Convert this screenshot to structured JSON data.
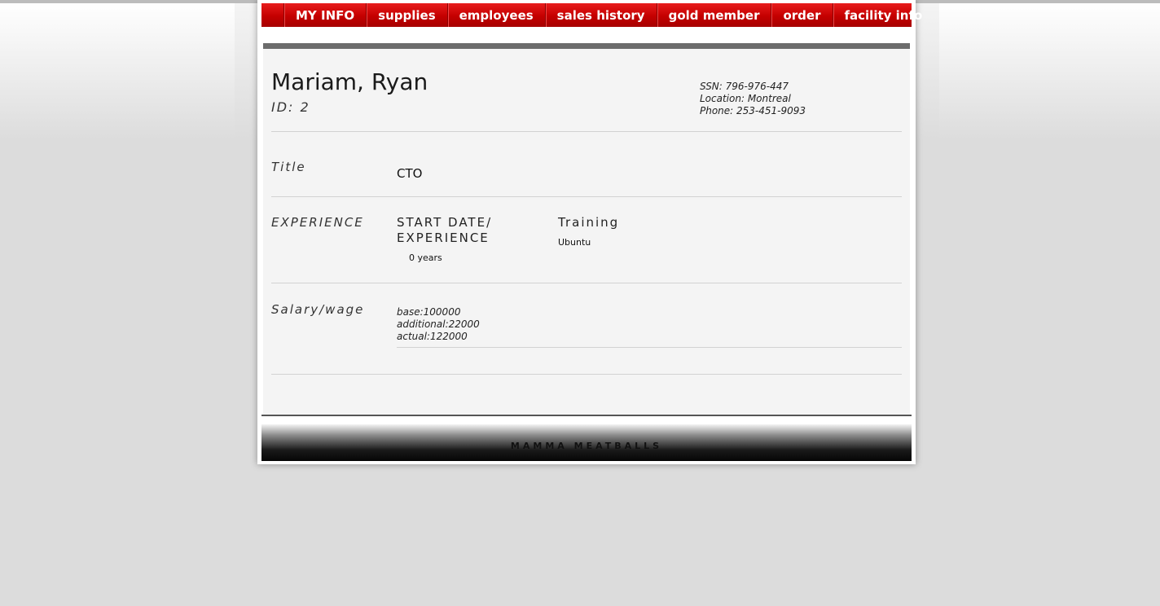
{
  "nav": [
    "MY INFO",
    "supplies",
    "employees",
    "sales history",
    "gold member",
    "order",
    "facility info"
  ],
  "employee": {
    "name": "Mariam, Ryan",
    "id": "ID: 2",
    "ssn": "SSN: 796-976-447",
    "location": "Location: Montreal",
    "phone": "Phone: 253-451-9093"
  },
  "title_section": {
    "label": "Title",
    "value": "CTO"
  },
  "experience_section": {
    "label": "EXPERIENCE",
    "start_date_heading_line1": "START DATE/",
    "start_date_heading_line2": "EXPERIENCE",
    "years": "0 years",
    "training_heading": "Training",
    "training_value": "Ubuntu"
  },
  "salary_section": {
    "label": "Salary/wage",
    "base": "base:100000",
    "additional": "additional:22000",
    "actual": "actual:122000"
  },
  "footer": {
    "text": "MAMMA MEATBALLS"
  },
  "colors": {
    "nav_red": "#c40000",
    "panel_bg": "#f4f4f4",
    "divider": "#6c6c6c"
  }
}
